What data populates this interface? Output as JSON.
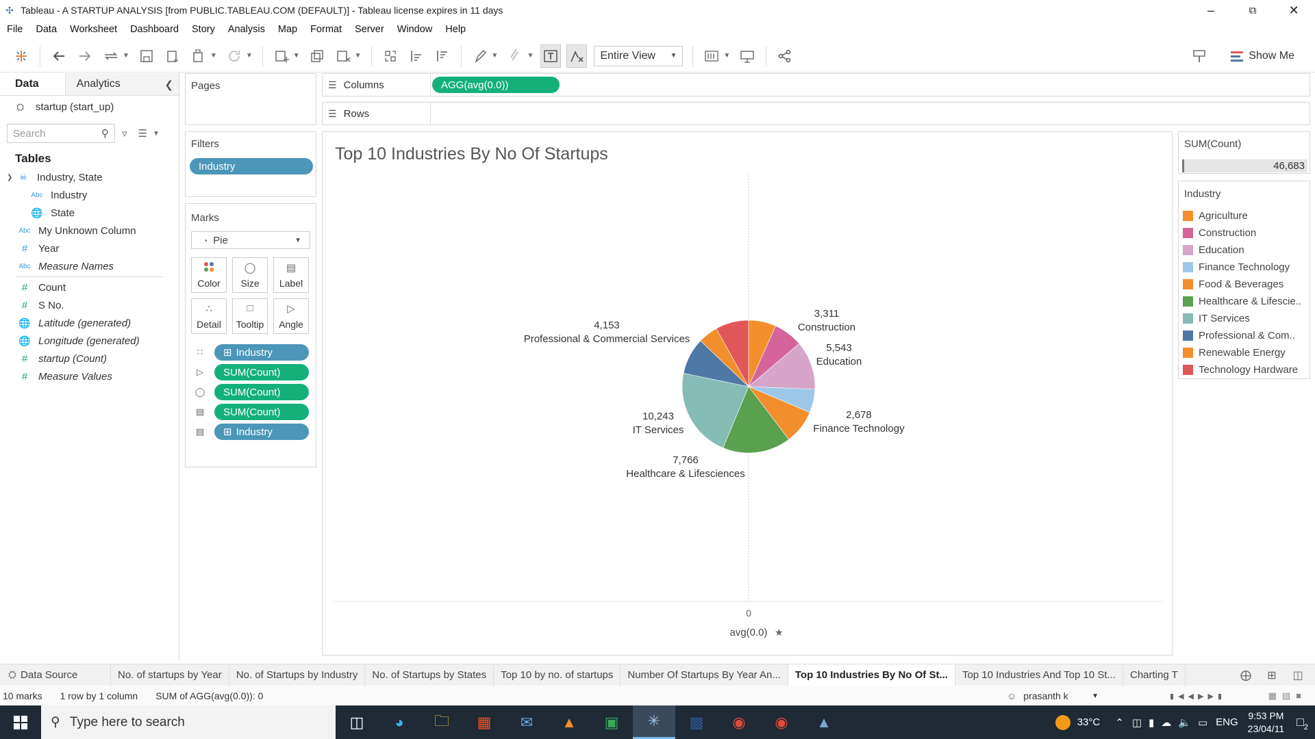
{
  "window": {
    "title": "Tableau - A STARTUP ANALYSIS [from PUBLIC.TABLEAU.COM (DEFAULT)] - Tableau license expires in 11 days",
    "app_icon": "tableau-icon"
  },
  "menu": [
    "File",
    "Data",
    "Worksheet",
    "Dashboard",
    "Story",
    "Analysis",
    "Map",
    "Format",
    "Server",
    "Window",
    "Help"
  ],
  "toolbar": {
    "view_mode": "Entire View",
    "show_me_label": "Show Me"
  },
  "data_pane": {
    "tab_data": "Data",
    "tab_analytics": "Analytics",
    "data_source": "startup (start_up)",
    "search_placeholder": "Search",
    "tables_heading": "Tables",
    "fields": [
      {
        "label": "Industry, State",
        "icon": "hierarchy-icon"
      },
      {
        "label": "Industry",
        "icon": "abc"
      },
      {
        "label": "State",
        "icon": "globe-icon"
      },
      {
        "label": "My Unknown Column",
        "icon": "abc"
      },
      {
        "label": "Year",
        "icon": "hash"
      },
      {
        "label": "Measure Names",
        "icon": "abc"
      },
      {
        "label": "Count",
        "icon": "hash"
      },
      {
        "label": "S No.",
        "icon": "hash"
      },
      {
        "label": "Latitude (generated)",
        "icon": "globe-icon"
      },
      {
        "label": "Longitude (generated)",
        "icon": "globe-icon"
      },
      {
        "label": "startup (Count)",
        "icon": "hash"
      },
      {
        "label": "Measure Values",
        "icon": "hash"
      }
    ],
    "abc_glyph": "Abc"
  },
  "pages_card": {
    "title": "Pages"
  },
  "filters_card": {
    "title": "Filters",
    "pill": "Industry"
  },
  "marks_card": {
    "title": "Marks",
    "mark_type": "Pie",
    "buttons": [
      "Color",
      "Size",
      "Label",
      "Detail",
      "Tooltip",
      "Angle"
    ],
    "fields": [
      {
        "pill": "Industry",
        "kind": "color"
      },
      {
        "pill": "SUM(Count)",
        "kind": "angle"
      },
      {
        "pill": "SUM(Count)",
        "kind": "size"
      },
      {
        "pill": "SUM(Count)",
        "kind": "label"
      },
      {
        "pill": "Industry",
        "kind": "label"
      }
    ]
  },
  "shelves": {
    "columns_label": "Columns",
    "columns_pill": "AGG(avg(0.0))",
    "rows_label": "Rows"
  },
  "viz": {
    "title": "Top 10 Industries By No Of Startups",
    "axis_tick": "0",
    "axis_label": "avg(0.0)"
  },
  "chart_data": {
    "type": "pie",
    "title": "Top 10 Industries By No Of Startups",
    "total": 46683,
    "slices": [
      {
        "name": "Agriculture",
        "value": 3114,
        "color": "#f28e2b",
        "labeled": false
      },
      {
        "name": "Construction",
        "value": 3311,
        "color": "#d4649a",
        "labeled": true
      },
      {
        "name": "Education",
        "value": 5543,
        "color": "#d7a5c9",
        "labeled": true
      },
      {
        "name": "Finance Technology",
        "value": 2678,
        "color": "#9dc8ea",
        "labeled": true
      },
      {
        "name": "Food & Beverages",
        "value": 3864,
        "color": "#f28e2b",
        "labeled": false
      },
      {
        "name": "Healthcare & Lifesciences",
        "value": 7766,
        "color": "#59a14f",
        "labeled": true
      },
      {
        "name": "IT Services",
        "value": 10243,
        "color": "#86bcb6",
        "labeled": true
      },
      {
        "name": "Professional & Commercial Services",
        "value": 4153,
        "color": "#4e79a7",
        "labeled": true
      },
      {
        "name": "Renewable Energy",
        "value": 2232,
        "color": "#f28e2b",
        "labeled": false
      },
      {
        "name": "Technology Hardware",
        "value": 3779,
        "color": "#e15759",
        "labeled": false
      }
    ],
    "slice_labels": [
      {
        "value": "3,311",
        "name": "Construction"
      },
      {
        "value": "5,543",
        "name": "Education"
      },
      {
        "value": "2,678",
        "name": "Finance Technology"
      },
      {
        "value": "7,766",
        "name": "Healthcare & Lifesciences"
      },
      {
        "value": "10,243",
        "name": "IT Services"
      },
      {
        "value": "4,153",
        "name": "Professional & Commercial Services"
      }
    ],
    "xlabel": "avg(0.0)",
    "x_tick": "0"
  },
  "size_legend": {
    "title": "SUM(Count)",
    "value": "46,683"
  },
  "color_legend": {
    "title": "Industry",
    "items": [
      {
        "label": "Agriculture",
        "color": "#f28e2b"
      },
      {
        "label": "Construction",
        "color": "#d4649a"
      },
      {
        "label": "Education",
        "color": "#d7a5c9"
      },
      {
        "label": "Finance Technology",
        "color": "#9dc8ea"
      },
      {
        "label": "Food & Beverages",
        "color": "#f28e2b"
      },
      {
        "label": "Healthcare & Lifescie..",
        "color": "#59a14f"
      },
      {
        "label": "IT Services",
        "color": "#86bcb6"
      },
      {
        "label": "Professional & Com..",
        "color": "#4e79a7"
      },
      {
        "label": "Renewable Energy",
        "color": "#f28e2b"
      },
      {
        "label": "Technology Hardware",
        "color": "#e15759"
      }
    ]
  },
  "sheet_tabs": {
    "data_source": "Data Source",
    "sheets": [
      "No. of startups by Year",
      "No. of Startups by Industry",
      "No. of Startups by States",
      "Top 10 by no. of startups",
      "Number Of Startups By Year An...",
      "Top 10 Industries By No Of St...",
      "Top 10 Industries And Top 10 St...",
      "Charting T"
    ],
    "active_index": 5
  },
  "status": {
    "marks": "10 marks",
    "rows_cols": "1 row by 1 column",
    "sum": "SUM of AGG(avg(0.0)): 0",
    "user": "prasanth k"
  },
  "taskbar": {
    "search_placeholder": "Type here to search",
    "temperature": "33°C",
    "language": "ENG",
    "time": "9:53 PM",
    "date": "23/04/11",
    "notification_count": "2"
  }
}
